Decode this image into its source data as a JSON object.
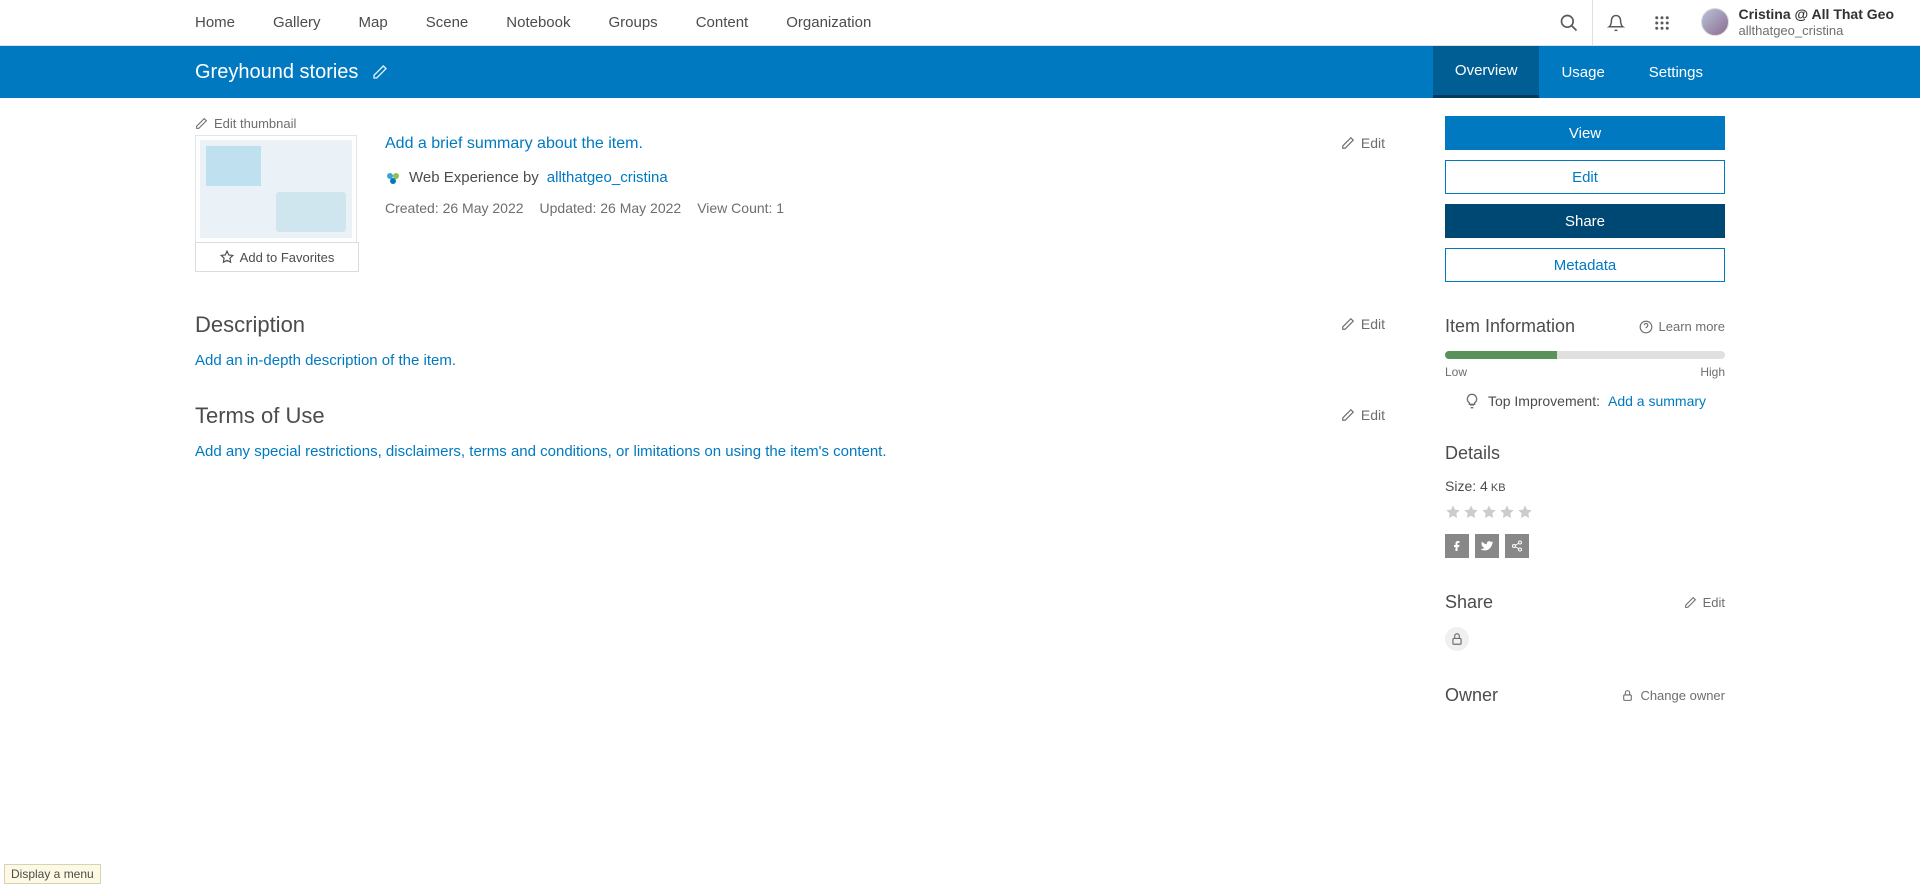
{
  "nav": {
    "items": [
      "Home",
      "Gallery",
      "Map",
      "Scene",
      "Notebook",
      "Groups",
      "Content",
      "Organization"
    ]
  },
  "user": {
    "display": "Cristina @ All That Geo",
    "username": "allthatgeo_cristina"
  },
  "item": {
    "title": "Greyhound stories",
    "tabs": [
      "Overview",
      "Usage",
      "Settings"
    ],
    "editThumbnail": "Edit thumbnail",
    "addFavorites": "Add to Favorites",
    "summaryPrompt": "Add a brief summary about the item.",
    "typeLabel": "Web Experience by",
    "author": "allthatgeo_cristina",
    "created": "Created: 26 May 2022",
    "updated": "Updated: 26 May 2022",
    "viewCount": "View Count: 1",
    "editLabel": "Edit"
  },
  "sections": {
    "description": {
      "heading": "Description",
      "prompt": "Add an in-depth description of the item."
    },
    "terms": {
      "heading": "Terms of Use",
      "prompt": "Add any special restrictions, disclaimers, terms and conditions, or limitations on using the item's content."
    }
  },
  "actions": {
    "view": "View",
    "edit": "Edit",
    "share": "Share",
    "metadata": "Metadata"
  },
  "info": {
    "heading": "Item Information",
    "learnMore": "Learn more",
    "low": "Low",
    "high": "High",
    "topImprovement": "Top Improvement:",
    "addSummary": "Add a summary"
  },
  "details": {
    "heading": "Details",
    "sizeLabel": "Size: 4",
    "sizeUnit": " KB"
  },
  "shareSection": {
    "heading": "Share",
    "edit": "Edit"
  },
  "owner": {
    "heading": "Owner",
    "change": "Change owner"
  },
  "tooltip": "Display a menu"
}
